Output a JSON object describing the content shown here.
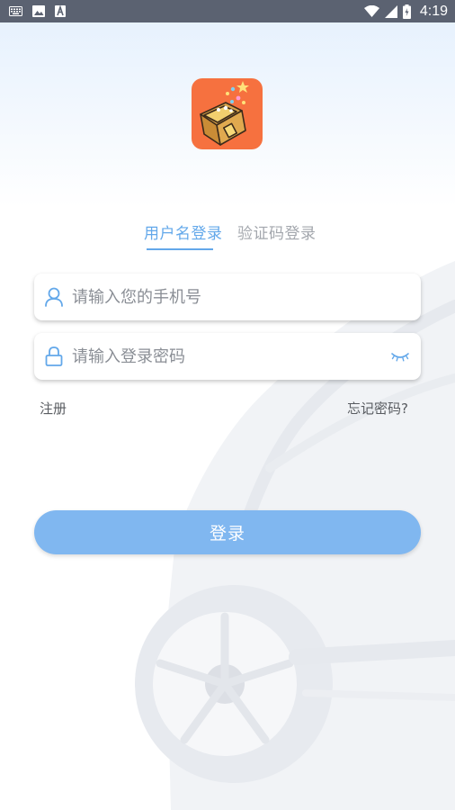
{
  "status_bar": {
    "time": "4:19",
    "icons": [
      "keyboard-icon",
      "image-icon",
      "font-a-icon",
      "wifi-icon",
      "signal-icon",
      "battery-icon"
    ]
  },
  "logo": {
    "name": "app-logo-treasure-chest",
    "color": "#f6713f"
  },
  "tabs": [
    {
      "label": "用户名登录",
      "active": true
    },
    {
      "label": "验证码登录",
      "active": false
    }
  ],
  "form": {
    "phone": {
      "value": "",
      "placeholder": "请输入您的手机号",
      "icon": "user-icon"
    },
    "password": {
      "value": "",
      "placeholder": "请输入登录密码",
      "icon": "lock-icon",
      "toggle_icon": "eye-closed-icon"
    }
  },
  "links": {
    "register": "注册",
    "forgot": "忘记密码?"
  },
  "login_button": {
    "label": "登录",
    "color": "#80b7f0"
  },
  "colors": {
    "accent": "#63a8ea",
    "inactive_tab": "#a3a7ad",
    "status_bar": "#5b6271"
  }
}
